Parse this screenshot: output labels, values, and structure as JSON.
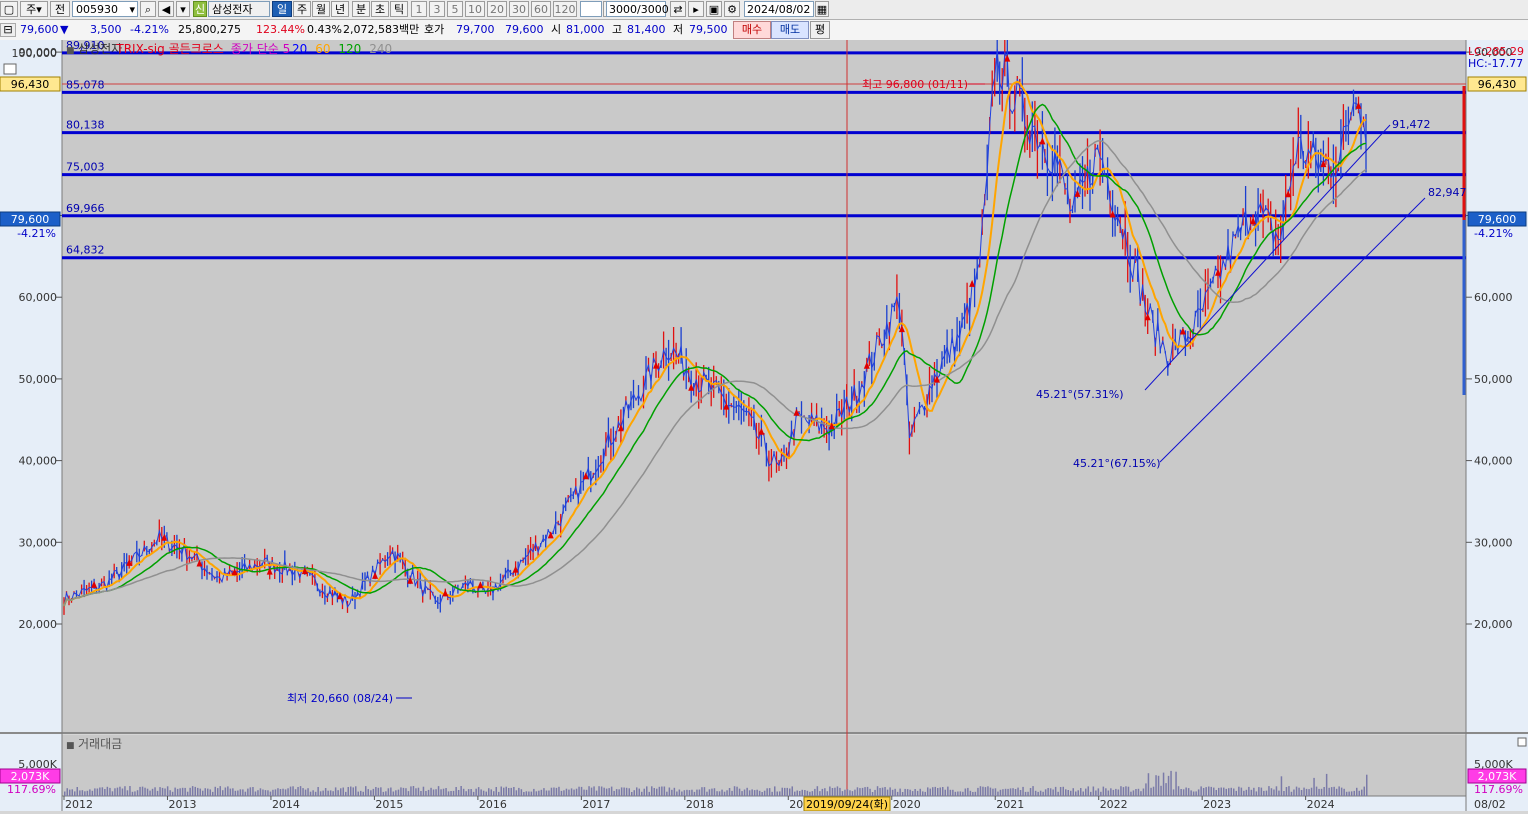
{
  "toolbar": {
    "period_label": "주",
    "compare_label": "전",
    "stock_code": "005930",
    "sin_badge": "신",
    "stock_name": "삼성전자",
    "period_tabs": [
      "일",
      "주",
      "월",
      "년",
      "분",
      "초",
      "틱"
    ],
    "interval_buttons": [
      "1",
      "3",
      "5",
      "10",
      "20",
      "30",
      "60",
      "120"
    ],
    "count_value": "3000",
    "count_max": "/3000",
    "date_value": "2024/08/02"
  },
  "quote": {
    "price": "79,600",
    "direction_arrow": "▼",
    "change": "3,500",
    "change_pct": "-4.21%",
    "volume": "25,800,275",
    "volume_ratio": "123.44%",
    "turnover": "0.43%",
    "trade_value": "2,072,583백만",
    "hoga_label": "호가",
    "ask": "79,700",
    "bid": "79,600",
    "open_label": "시",
    "open": "81,000",
    "high_label": "고",
    "high": "81,400",
    "low_label": "저",
    "low": "79,500",
    "buy_button": "매수",
    "sell_button": "매도",
    "eval_button": "평"
  },
  "legend": {
    "name": "삼성전자",
    "indicator": "TRIX-sig 골든크로스",
    "ma_label": "종가 단순 5",
    "ma_periods": [
      "20",
      "60",
      "120",
      "240"
    ],
    "ma_colors": [
      "#0000ff",
      "#ffa500",
      "#00a000",
      "#909090"
    ]
  },
  "price_panel": {
    "top_axis_label": "100,000",
    "max_marker": "96,430",
    "current_marker": "79,600",
    "current_pct": "-4.21%",
    "lc_label": "LC:285.29",
    "hc_label": "HC:-17.77",
    "right_max_marker": "96,430",
    "right_current_marker": "79,600",
    "right_current_pct": "-4.21%",
    "high_annotation": "최고 96,800 (01/11)",
    "low_annotation": "최저 20,660 (08/24)",
    "channel_labels": [
      {
        "text": "91,472"
      },
      {
        "text": "82,947"
      },
      {
        "text": "45.21°(57.31%)"
      },
      {
        "text": "45.21°(67.15%)"
      }
    ],
    "fib_lines": [
      {
        "value": 89910,
        "label": "89,910"
      },
      {
        "value": 85078,
        "label": "85,078"
      },
      {
        "value": 80138,
        "label": "80,138"
      },
      {
        "value": 75003,
        "label": "75,003"
      },
      {
        "value": 69966,
        "label": "69,966"
      },
      {
        "value": 64832,
        "label": "64,832"
      }
    ],
    "y_ticks": [
      {
        "value": 90000,
        "label": "90,000"
      },
      {
        "value": 70000,
        "label": "70,000"
      },
      {
        "value": 60000,
        "label": "60,000"
      },
      {
        "value": 50000,
        "label": "50,000"
      },
      {
        "value": 40000,
        "label": "40,000"
      },
      {
        "value": 30000,
        "label": "30,000"
      },
      {
        "value": 20000,
        "label": "20,000"
      }
    ]
  },
  "volume_panel": {
    "title": "거래대금",
    "axis_label": "5,000K",
    "left_marker": "2,073K",
    "left_pct": "117.69%",
    "right_axis_label": "5,000K",
    "right_marker": "2,073K",
    "right_pct": "117.69%"
  },
  "x_axis": {
    "years": [
      "2012",
      "2013",
      "2014",
      "2015",
      "2016",
      "2017",
      "2018",
      "2019",
      "2020",
      "2021",
      "2022",
      "2023",
      "2024"
    ],
    "cursor_date": "2019/09/24(화)",
    "end_label": "08/02"
  },
  "chart_data": {
    "type": "candlestick",
    "title": "삼성전자",
    "ylim": [
      17000,
      102000
    ],
    "xlim": [
      "2012-01",
      "2024-08"
    ],
    "y_scale": "linear",
    "grid": false,
    "moving_averages": [
      "5",
      "20",
      "60",
      "120",
      "240"
    ],
    "series": [
      {
        "name": "종가",
        "x": [
          "2012-01",
          "2012-06",
          "2012-12",
          "2013-03",
          "2013-07",
          "2013-12",
          "2014-04",
          "2014-10",
          "2015-03",
          "2015-08",
          "2015-12",
          "2016-02",
          "2016-06",
          "2016-10",
          "2017-02",
          "2017-06",
          "2017-11",
          "2018-03",
          "2018-08",
          "2018-12",
          "2019-02",
          "2019-06",
          "2019-09",
          "2019-12",
          "2020-02",
          "2020-03",
          "2020-06",
          "2020-09",
          "2020-11",
          "2020-12",
          "2021-01",
          "2021-04",
          "2021-08",
          "2021-10",
          "2022-01",
          "2022-04",
          "2022-07",
          "2022-09",
          "2022-12",
          "2023-04",
          "2023-07",
          "2023-10",
          "2023-12",
          "2024-03",
          "2024-05",
          "2024-07",
          "2024-08"
        ],
        "values": [
          23000,
          25000,
          30500,
          29000,
          25500,
          27500,
          26500,
          22500,
          29000,
          22500,
          25000,
          23500,
          27500,
          32000,
          38500,
          45500,
          54000,
          49500,
          45500,
          38500,
          45000,
          44000,
          48500,
          55500,
          60000,
          42500,
          50500,
          55500,
          62500,
          73000,
          89500,
          83000,
          77000,
          70000,
          78000,
          68000,
          57000,
          53000,
          56000,
          65000,
          71000,
          67000,
          78500,
          76000,
          77000,
          86500,
          79600
        ]
      }
    ]
  }
}
